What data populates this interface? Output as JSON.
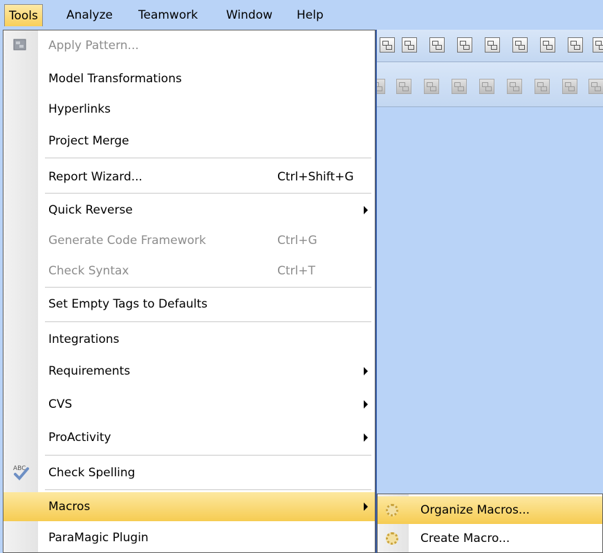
{
  "menubar": {
    "items": [
      {
        "label": "Tools"
      },
      {
        "label": "Analyze"
      },
      {
        "label": "Teamwork"
      },
      {
        "label": "Window"
      },
      {
        "label": "Help"
      }
    ]
  },
  "tools_menu": {
    "items": [
      {
        "label": "Apply Pattern...",
        "shortcut": "",
        "enabled": false
      },
      {
        "label": "Model Transformations",
        "shortcut": ""
      },
      {
        "label": "Hyperlinks",
        "shortcut": ""
      },
      {
        "label": "Project Merge",
        "shortcut": ""
      },
      {
        "label": "Report Wizard...",
        "shortcut": "Ctrl+Shift+G"
      },
      {
        "label": "Quick Reverse",
        "shortcut": "",
        "submenu": true
      },
      {
        "label": "Generate Code Framework",
        "shortcut": "Ctrl+G",
        "enabled": false
      },
      {
        "label": "Check Syntax",
        "shortcut": "Ctrl+T",
        "enabled": false
      },
      {
        "label": "Set Empty Tags to Defaults",
        "shortcut": ""
      },
      {
        "label": "Integrations",
        "shortcut": ""
      },
      {
        "label": "Requirements",
        "shortcut": "",
        "submenu": true
      },
      {
        "label": "CVS",
        "shortcut": "",
        "submenu": true
      },
      {
        "label": "ProActivity",
        "shortcut": "",
        "submenu": true
      },
      {
        "label": "Check Spelling",
        "shortcut": "",
        "icon": "spell-check-icon"
      },
      {
        "label": "Macros",
        "shortcut": "",
        "submenu": true,
        "selected": true
      },
      {
        "label": "ParaMagic Plugin",
        "shortcut": ""
      }
    ]
  },
  "macros_submenu": {
    "items": [
      {
        "label": "Organize Macros...",
        "icon": "gear-icon",
        "selected": true
      },
      {
        "label": "Create Macro...",
        "icon": "gear-icon"
      }
    ]
  },
  "colors": {
    "background": "#b9d3f7",
    "highlight": "#f6cc52",
    "disabled_text": "#8c8c8c"
  }
}
